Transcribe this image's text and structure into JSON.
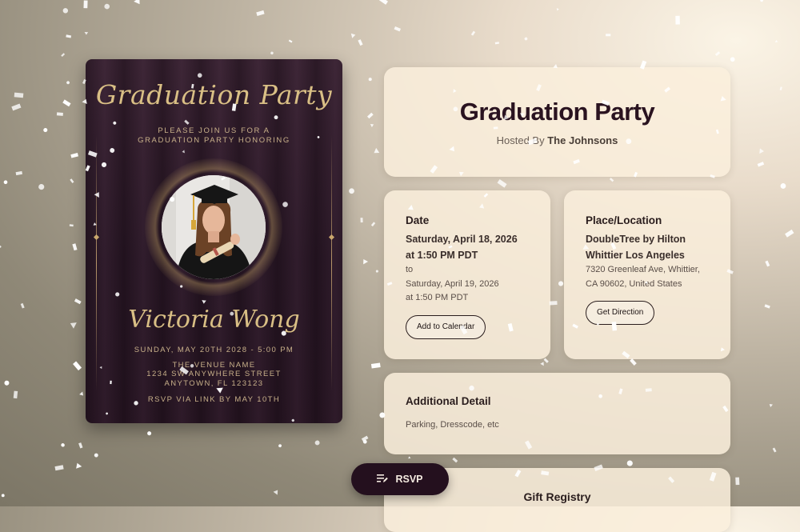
{
  "invitation": {
    "title": "Graduation Party",
    "subtitle_line1": "Please join us for a",
    "subtitle_line2": "graduation party honoring",
    "honoree": "Victoria Wong",
    "date_time": "Sunday, May 20th 2028 - 5:00 PM",
    "venue": "The Venue Name",
    "street": "1234 SW Anywhere Street",
    "city": "Anytown, FL 123123",
    "rsvp_note": "RSVP via link by May 10th"
  },
  "event": {
    "title": "Graduation Party",
    "hosted_prefix": "Hosted By",
    "host": "The Johnsons"
  },
  "date_card": {
    "label": "Date",
    "start_date": "Saturday, April 18, 2026",
    "start_time": "at 1:50 PM PDT",
    "to": "to",
    "end_date": "Saturday, April 19, 2026",
    "end_time": "at 1:50 PM PDT",
    "button": "Add to Calendar"
  },
  "place_card": {
    "label": "Place/Location",
    "venue_line1": "DoubleTree by Hilton",
    "venue_line2": "Whittier Los Angeles",
    "address_line1": "7320 Greenleaf Ave, Whittier,",
    "address_line2": "CA 90602, United States",
    "button": "Get Direction"
  },
  "detail_card": {
    "label": "Additional Detail",
    "text": "Parking, Dresscode, etc"
  },
  "gift_card": {
    "label": "Gift Registry"
  },
  "rsvp_button": {
    "label": "RSVP",
    "icon": "edit-list-icon"
  },
  "colors": {
    "accent_dark": "#24101e",
    "gold": "#d9bf85",
    "card_bg": "#faeedc"
  }
}
